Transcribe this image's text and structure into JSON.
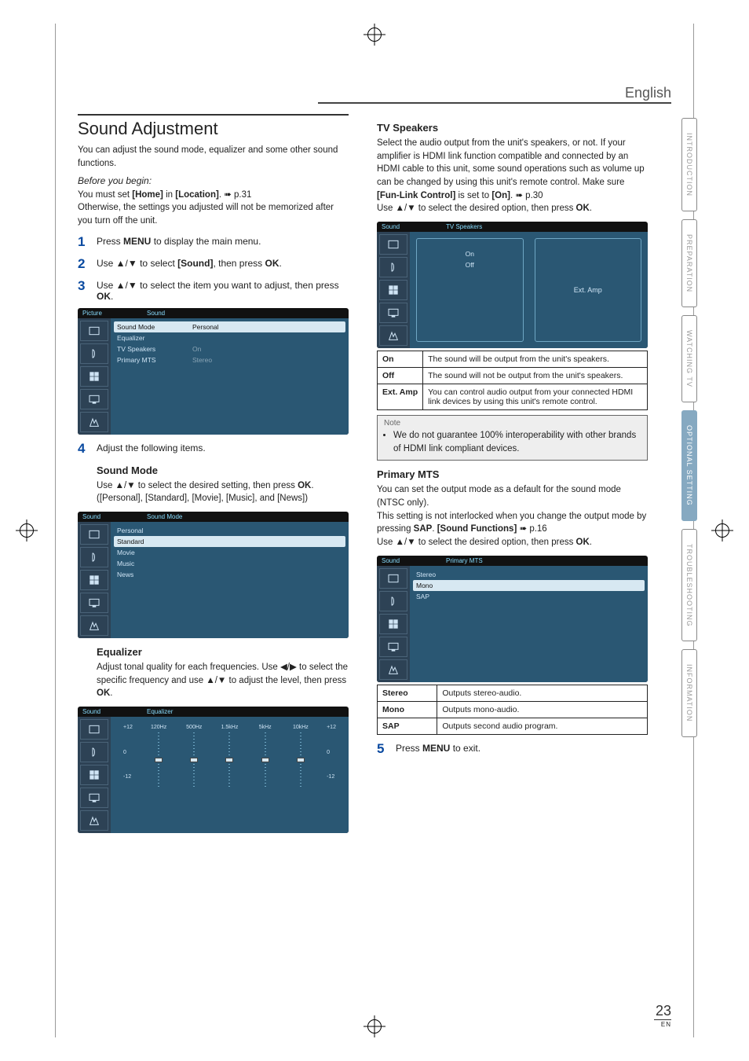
{
  "lang_header": "English",
  "tabs": {
    "intro": "INTRODUCTION",
    "prep": "PREPARATION",
    "watch": "WATCHING TV",
    "opt": "OPTIONAL SETTING",
    "trouble": "TROUBLESHOOTING",
    "info": "INFORMATION"
  },
  "left": {
    "h1": "Sound Adjustment",
    "intro_p": "You can adjust the sound mode, equalizer and some other sound functions.",
    "before_heading": "Before you begin:",
    "before_line1_pre": "You must set ",
    "before_line1_b1": "[Home]",
    "before_line1_mid": " in ",
    "before_line1_b2": "[Location]",
    "before_line1_post": ". ➠ p.31",
    "before_line2": "Otherwise, the settings you adjusted will not be memorized after you turn off the unit.",
    "step1_pre": "Press ",
    "step1_b": "MENU",
    "step1_post": " to display the main menu.",
    "step2_pre": "Use ▲/▼ to select ",
    "step2_b": "[Sound]",
    "step2_mid": ", then press ",
    "step2_b2": "OK",
    "step2_post": ".",
    "step3_pre": "Use ▲/▼ to select the item you want to adjust, then press ",
    "step3_b": "OK",
    "step3_post": ".",
    "ui_sound_title_l": "Picture",
    "ui_sound_title_r": "Sound",
    "ui_sound_rows": [
      {
        "label": "Sound Mode",
        "val": "Personal",
        "hi": true
      },
      {
        "label": "Equalizer",
        "val": ""
      },
      {
        "label": "TV Speakers",
        "val": "On"
      },
      {
        "label": "Primary MTS",
        "val": "Stereo"
      }
    ],
    "step4": "Adjust the following items.",
    "sound_mode_h": "Sound Mode",
    "sound_mode_p_pre": "Use ▲/▼ to select the desired setting, then press ",
    "sound_mode_p_b": "OK",
    "sound_mode_p_post": ".",
    "sound_mode_opts": "([Personal], [Standard], [Movie], [Music], and [News])",
    "ui_mode_title_l": "Sound",
    "ui_mode_title_r": "Sound Mode",
    "ui_mode_rows": [
      {
        "label": "Personal"
      },
      {
        "label": "Standard",
        "hi": true
      },
      {
        "label": "Movie"
      },
      {
        "label": "Music"
      },
      {
        "label": "News"
      }
    ],
    "eq_h": "Equalizer",
    "eq_p_pre": "Adjust tonal quality for each frequencies. Use ◀/▶ to select the specific frequency and use ▲/▼ to adjust the level, then press ",
    "eq_p_b": "OK",
    "eq_p_post": ".",
    "ui_eq_title_l": "Sound",
    "ui_eq_title_r": "Equalizer",
    "eq_freqs": [
      "120Hz",
      "500Hz",
      "1.5kHz",
      "5kHz",
      "10kHz"
    ],
    "eq_center": "0",
    "eq_max": "+12",
    "eq_min": "-12"
  },
  "right": {
    "tvspk_h": "TV Speakers",
    "tvspk_p_pre": "Select the audio output from the unit's speakers, or not. If your amplifier is HDMI link function compatible and connected by an HDMI cable to this unit, some sound operations such as volume up can be changed by using this unit's remote control. Make sure ",
    "tvspk_p_b1": "[Fun-Link Control]",
    "tvspk_p_mid": " is set to ",
    "tvspk_p_b2": "[On]",
    "tvspk_p_post": ". ➠ p.30",
    "tvspk_use_pre": "Use ▲/▼ to select the desired option, then press ",
    "tvspk_use_b": "OK",
    "tvspk_use_post": ".",
    "ui_tvspk_title_l": "Sound",
    "ui_tvspk_title_r": "TV Speakers",
    "ui_tvspk_opts_top": "On",
    "ui_tvspk_opts_mid": "Off",
    "ui_tvspk_opts_bot": "Ext. Amp",
    "tvspk_tbl": [
      {
        "k": "On",
        "v": "The sound will be output from the unit's speakers."
      },
      {
        "k": "Off",
        "v": "The sound will not be output from the unit's speakers."
      },
      {
        "k": "Ext. Amp",
        "v": "You can control audio output from your connected HDMI link devices by using this unit's remote control."
      }
    ],
    "note_title": "Note",
    "note_body": "We do not guarantee 100% interoperability with other brands of HDMI link compliant devices.",
    "mts_h": "Primary MTS",
    "mts_p1": "You can set the output mode as a default for the sound mode (NTSC only).",
    "mts_p2_pre": "This setting is not interlocked when you change the output mode by pressing ",
    "mts_p2_b1": "SAP",
    "mts_p2_mid": ". ",
    "mts_p2_b2": "[Sound Functions]",
    "mts_p2_post": " ➠ p.16",
    "mts_use_pre": "Use ▲/▼ to select the desired option, then press ",
    "mts_use_b": "OK",
    "mts_use_post": ".",
    "ui_mts_title_l": "Sound",
    "ui_mts_title_r": "Primary MTS",
    "ui_mts_rows": [
      {
        "label": "Stereo"
      },
      {
        "label": "Mono",
        "hi": true
      },
      {
        "label": "SAP"
      }
    ],
    "mts_tbl": [
      {
        "k": "Stereo",
        "v": "Outputs stereo-audio."
      },
      {
        "k": "Mono",
        "v": "Outputs mono-audio."
      },
      {
        "k": "SAP",
        "v": "Outputs second audio program."
      }
    ],
    "step5_pre": "Press ",
    "step5_b": "MENU",
    "step5_post": " to exit."
  },
  "page_num": "23",
  "page_lang": "EN"
}
